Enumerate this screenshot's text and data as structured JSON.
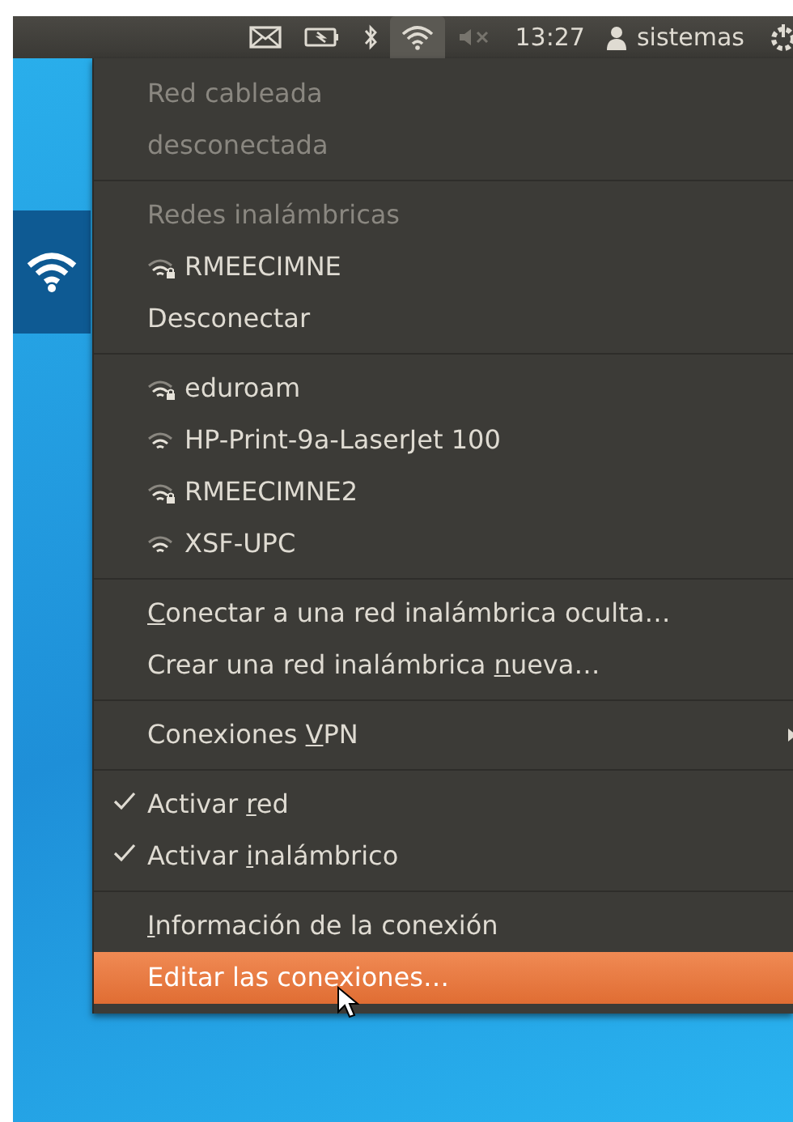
{
  "top_panel": {
    "indicators": [
      {
        "kind": "mail",
        "selected": false
      },
      {
        "kind": "battery",
        "selected": false
      },
      {
        "kind": "bluetooth",
        "selected": false
      },
      {
        "kind": "wifi",
        "selected": true
      },
      {
        "kind": "volume-muted",
        "selected": false
      }
    ],
    "clock": "13:27",
    "user": "sistemas"
  },
  "menu": {
    "sections": [
      [
        {
          "kind": "header",
          "label": "Red cableada",
          "disabled": true
        },
        {
          "kind": "header",
          "label": "desconectada",
          "disabled": true
        }
      ],
      [
        {
          "kind": "header",
          "label": "Redes inalámbricas",
          "disabled": true
        },
        {
          "kind": "network",
          "label": "RMEECIMNE",
          "locked": true,
          "selected": false
        },
        {
          "kind": "action",
          "label": "Desconectar",
          "selected": false
        }
      ],
      [
        {
          "kind": "network",
          "label": "eduroam",
          "locked": true,
          "selected": false
        },
        {
          "kind": "network",
          "label": "HP-Print-9a-LaserJet 100",
          "locked": false,
          "selected": false
        },
        {
          "kind": "network",
          "label": "RMEECIMNE2",
          "locked": true,
          "selected": false
        },
        {
          "kind": "network",
          "label": "XSF-UPC",
          "locked": false,
          "selected": false
        }
      ],
      [
        {
          "kind": "action",
          "label": {
            "key": "C",
            "after": "onectar a una red inalámbrica oculta…"
          },
          "selected": false
        },
        {
          "kind": "action",
          "label": {
            "before": "Crear una red inalámbrica ",
            "key": "n",
            "after": "ueva…"
          },
          "selected": false
        }
      ],
      [
        {
          "kind": "submenu",
          "label": {
            "before": "Conexiones ",
            "key": "V",
            "after": "PN"
          },
          "selected": false
        }
      ],
      [
        {
          "kind": "check",
          "label": {
            "before": "Activar ",
            "key": "r",
            "after": "ed"
          },
          "checked": true,
          "selected": false
        },
        {
          "kind": "check",
          "label": {
            "before": "Activar ",
            "key": "i",
            "after": "nalámbrico"
          },
          "checked": true,
          "selected": false
        }
      ],
      [
        {
          "kind": "action",
          "label": {
            "key": "I",
            "after": "nformación de la conexión"
          },
          "selected": false
        },
        {
          "kind": "action",
          "label": "Editar las conexiones…",
          "selected": true
        }
      ]
    ]
  }
}
